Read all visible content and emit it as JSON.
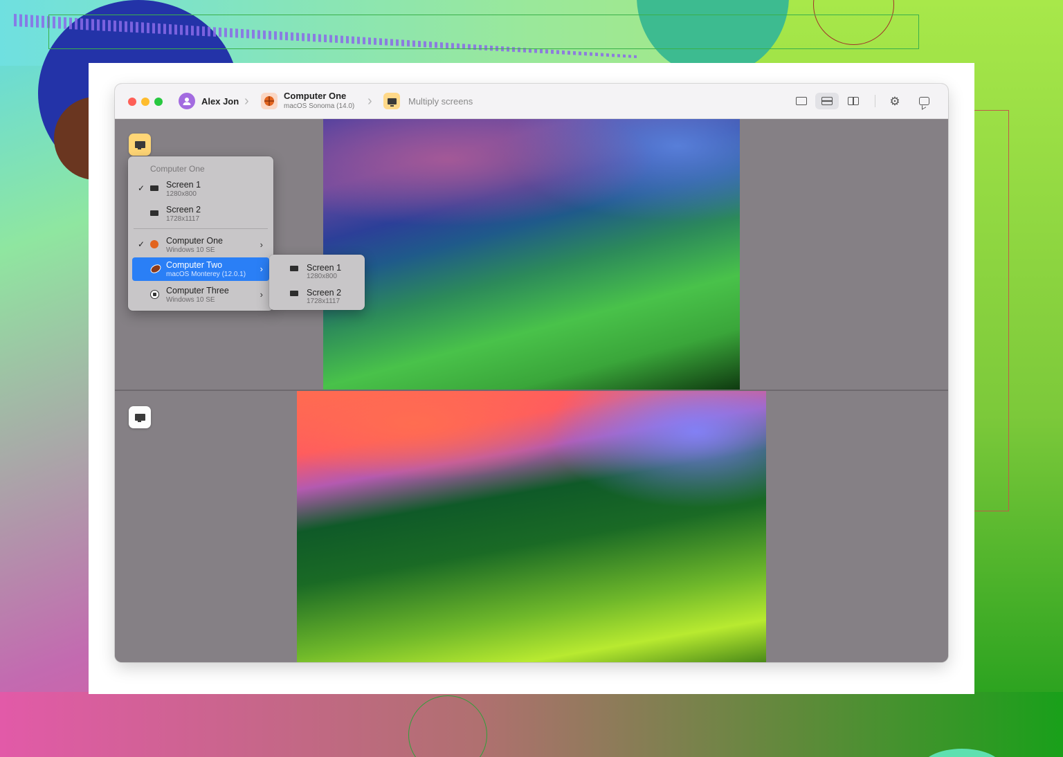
{
  "toolbar": {
    "user_name": "Alex Jon",
    "computer_title": "Computer One",
    "computer_os": "macOS Sonoma (14.0)",
    "mode_label": "Multiply screens"
  },
  "menu": {
    "header": "Computer One",
    "items": [
      {
        "title": "Screen 1",
        "sub": "1280x800",
        "checked": true
      },
      {
        "title": "Screen 2",
        "sub": "1728x1117",
        "checked": false
      },
      {
        "title": "Computer One",
        "sub": "Windows 10 SE",
        "checked": true
      },
      {
        "title": "Computer Two",
        "sub": "macOS Monterey (12.0.1)",
        "checked": false
      },
      {
        "title": "Computer Three",
        "sub": "Windows 10 SE",
        "checked": false
      }
    ]
  },
  "submenu": {
    "items": [
      {
        "title": "Screen 1",
        "sub": "1280x800"
      },
      {
        "title": "Screen 2",
        "sub": "1728x1117"
      }
    ]
  },
  "glyphs": {
    "check": "✓",
    "arrow": "›",
    "crumb_sep": "›",
    "gear": "⚙"
  },
  "colors": {
    "accent": "#2a7ff6",
    "close": "#fe5f57",
    "minimize": "#febc2e",
    "maximize": "#28c840",
    "avatar": "#a36be0"
  },
  "icons": {
    "user": "user-icon",
    "computer": "basketball-icon",
    "screen": "monitor-icon",
    "layout_single": "single-pane-icon",
    "layout_horizontal": "horizontal-split-icon",
    "layout_vertical": "vertical-split-icon",
    "settings": "gear-icon",
    "chat": "chat-bubble-icon"
  }
}
